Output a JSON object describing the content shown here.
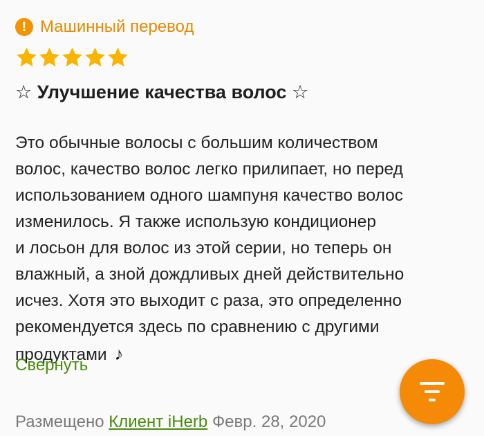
{
  "badge": {
    "icon": "exclamation-icon",
    "label": "Машинный перевод",
    "color": "#f39300"
  },
  "rating": {
    "value": 5,
    "max": 5,
    "star_color": "#f7b500"
  },
  "review": {
    "title_deco_left": "☆",
    "title": "Улучшение качества волос",
    "title_deco_right": "☆",
    "body": "Это обычные волосы с большим количеством\nволос, качество волос легко прилипает, но перед\nиспользованием одного шампуня качество волос\nизменилось. Я также использую кондиционер\nи лосьон для волос из этой серии, но теперь он\nвлажный, а зной дождливых дней действительно\nисчез. Хотя это выходит с раза, это определенно\nрекомендуется здесь по сравнению с другими\nпродуктами",
    "body_end_icon": "♪",
    "collapse_label": "Свернуть"
  },
  "meta": {
    "posted_prefix": "Размещено",
    "author": "Клиент iHerb",
    "date": "Февр. 28, 2020"
  },
  "fab": {
    "icon": "filter-menu-icon",
    "color": "#f58a07"
  }
}
